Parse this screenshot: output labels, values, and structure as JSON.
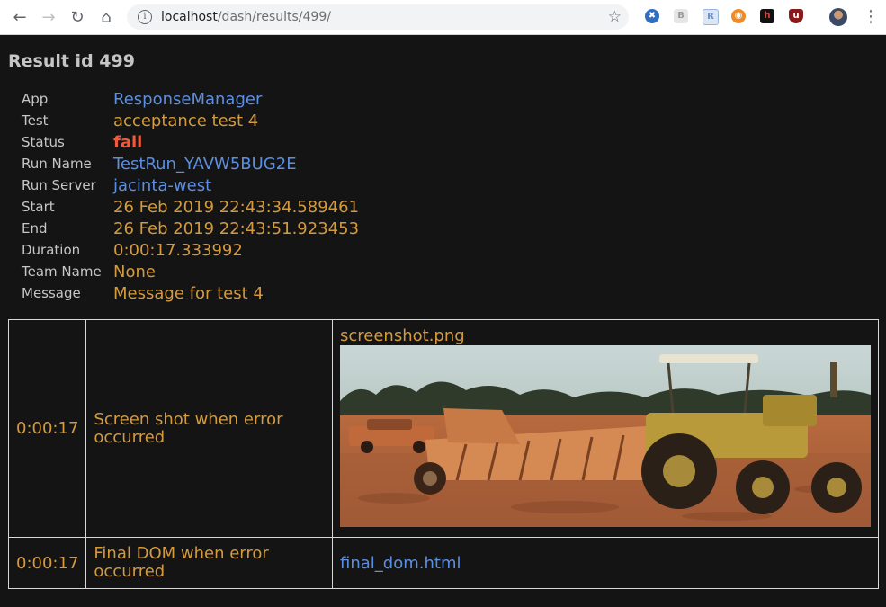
{
  "browser": {
    "url_host": "localhost",
    "url_path": "/dash/results/499/"
  },
  "page": {
    "title": "Result id 499",
    "fields": [
      {
        "label": "App",
        "value": "ResponseManager",
        "color": "#5d8fe0"
      },
      {
        "label": "Test",
        "value": "acceptance test 4",
        "color": "#d49a3e"
      },
      {
        "label": "Status",
        "value": "fail",
        "color": "#ee5a3c"
      },
      {
        "label": "Run Name",
        "value": "TestRun_YAVW5BUG2E",
        "color": "#5d8fe0"
      },
      {
        "label": "Run Server",
        "value": "jacinta-west",
        "color": "#5d8fe0"
      },
      {
        "label": "Start",
        "value": "26 Feb 2019 22:43:34.589461",
        "color": "#d49a3e"
      },
      {
        "label": "End",
        "value": "26 Feb 2019 22:43:51.923453",
        "color": "#d49a3e"
      },
      {
        "label": "Duration",
        "value": "0:00:17.333992",
        "color": "#d49a3e"
      },
      {
        "label": "Team Name",
        "value": "None",
        "color": "#d49a3e"
      },
      {
        "label": "Message",
        "value": "Message for test 4",
        "color": "#d49a3e"
      }
    ],
    "artifacts": [
      {
        "time": "0:00:17",
        "description": "Screen shot when error occurred",
        "file": "screenshot.png",
        "kind": "image",
        "image_subject": "tractor-pulling-farm-implement-in-field"
      },
      {
        "time": "0:00:17",
        "description": "Final DOM when error occurred",
        "file": "final_dom.html",
        "kind": "link"
      }
    ]
  },
  "icons": {
    "back": "arrow-left-icon",
    "forward": "arrow-right-icon",
    "reload": "reload-icon",
    "home": "home-icon",
    "site_info": "info-icon",
    "bookmark": "star-icon",
    "menu": "kebab-menu-icon"
  }
}
